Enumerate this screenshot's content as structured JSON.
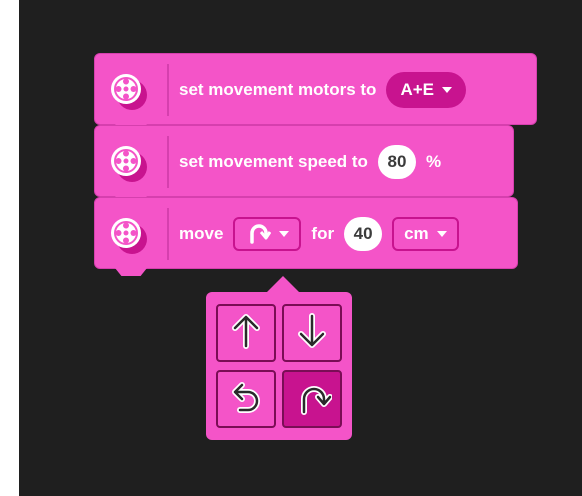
{
  "blocks": [
    {
      "id": "motors",
      "label": "set movement motors to",
      "dropdown_value": "A+E",
      "icon": "motor-icon"
    },
    {
      "id": "speed",
      "label": "set movement speed to",
      "value": "80",
      "unit": "%",
      "icon": "motor-icon"
    },
    {
      "id": "move",
      "label": "move",
      "direction_icon": "turn-right-icon",
      "for_label": "for",
      "value": "40",
      "unit": "cm",
      "icon": "motor-icon"
    }
  ],
  "direction_menu": {
    "options": [
      {
        "icon": "arrow-up-icon",
        "selected": false
      },
      {
        "icon": "arrow-down-icon",
        "selected": false
      },
      {
        "icon": "turn-left-icon",
        "selected": false
      },
      {
        "icon": "turn-right-icon",
        "selected": true
      }
    ]
  },
  "colors": {
    "block": "#f454c8",
    "dropdown": "#c8138f",
    "canvas": "#1f1f1f"
  }
}
